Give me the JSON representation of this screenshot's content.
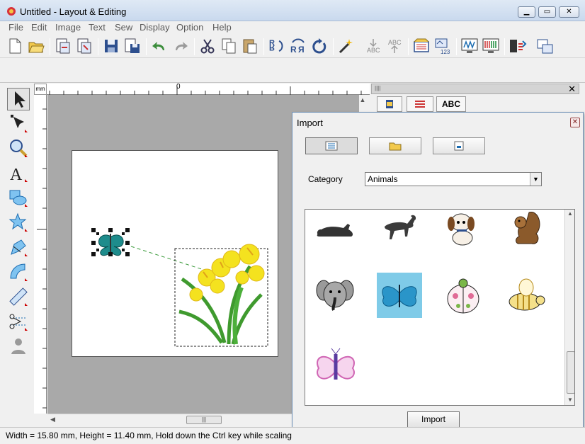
{
  "window": {
    "title": "Untitled - Layout & Editing"
  },
  "menu": [
    "File",
    "Edit",
    "Image",
    "Text",
    "Sew",
    "Display",
    "Option",
    "Help"
  ],
  "ruler": {
    "unit": "mm",
    "zero_label": "0"
  },
  "palette": {
    "abc_tab": "ABC"
  },
  "dialog": {
    "title": "Import",
    "category_label": "Category",
    "category_value": "Animals",
    "import_button": "Import"
  },
  "status": {
    "text": "Width  = 15.80 mm, Height = 11.40 mm, Hold down the Ctrl key while scaling"
  },
  "colors": {
    "titlebar": "#dfe9f5",
    "dialog_border": "#6d8fb6",
    "canvas_bg": "#a9a9a9"
  },
  "icons": {
    "toolbar": [
      "new-file-icon",
      "open-folder-icon",
      "import-design-icon",
      "export-design-icon",
      "save-icon",
      "save-as-icon",
      "undo-icon",
      "redo-icon",
      "cut-icon",
      "copy-icon",
      "paste-icon",
      "flip-vertical-icon",
      "flip-horizontal-icon",
      "rotate-icon",
      "magic-wand-icon",
      "arrange-text-icon",
      "release-text-icon",
      "hoop-icon",
      "design-property-icon",
      "realistic-preview-icon",
      "preview-icon",
      "send-to-card-icon",
      "write-to-card-icon"
    ],
    "tools": [
      "select-arrow-icon",
      "point-edit-icon",
      "zoom-icon",
      "text-icon",
      "shape-icon",
      "star-shape-icon",
      "stamp-icon",
      "arc-text-icon",
      "measure-icon",
      "applique-icon",
      "import-image-icon"
    ]
  }
}
